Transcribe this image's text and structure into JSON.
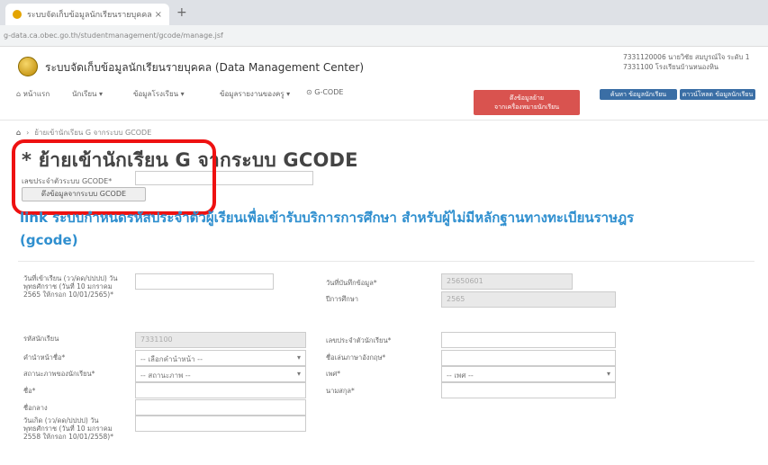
{
  "browser": {
    "tab_title": "ระบบจัดเก็บข้อมูลนักเรียนรายบุคคล",
    "tab_close": "×",
    "new_tab": "+",
    "url": "g-data.ca.obec.go.th/studentmanagement/gcode/manage.jsf"
  },
  "header": {
    "site_title": "ระบบจัดเก็บข้อมูลนักเรียนรายบุคคล (Data Management Center)",
    "user_line1": "7331120006 นายวิชัย สมบูรณ์ใจ  ระดับ 1",
    "user_line2": "7331100 โรงเรียนบ้านหนองหิน"
  },
  "nav": {
    "items": [
      "หน้าแรก",
      "นักเรียน ▾",
      "ข้อมูลโรงเรียน ▾",
      "ข้อมูลรายงานของครู ▾",
      "G-CODE"
    ],
    "red_button": "ดึงข้อมูลย้าย\nจากเครื่องหมายนักเรียน",
    "blue_buttons": [
      "ค้นหา ข้อมูลนักเรียน",
      "ดาวน์โหลด ข้อมูลนักเรียน"
    ]
  },
  "breadcrumb": {
    "home_icon": "home-icon",
    "separator": "›",
    "text": "ย้ายเข้านักเรียน G จากระบบ GCODE"
  },
  "page": {
    "title": "* ย้ายเข้านักเรียน G จากระบบ GCODE",
    "gcode_label": "เลขประจำตัวระบบ GCODE*",
    "gcode_value": "",
    "gcode_button": "ดึงข้อมูลจากระบบ GCODE",
    "link_text": "link ระบบกำหนดรหัสประจำตัวผู้เรียนเพื่อเข้ารับบริการการศึกษา สำหรับผู้ไม่มีหลักฐานทางทะเบียนราษฎร (gcode)"
  },
  "form": {
    "left": [
      {
        "label": "วันที่เข้าเรียน (วว/ดด/ปปปป) วันพุทธศักราช (วันที่ 10 มกราคม 2565 ให้กรอก 10/01/2565)*",
        "value": "",
        "type": "input"
      },
      {
        "label": "รหัสนักเรียน",
        "value": "7331100",
        "type": "input-disabled"
      },
      {
        "label": "คำนำหน้าชื่อ*",
        "value": "-- เลือกคำนำหน้า --",
        "type": "select"
      },
      {
        "label": "สถานะภาพของนักเรียน*",
        "value": "-- สถานะภาพ --",
        "type": "select"
      },
      {
        "label": "ชื่อ*",
        "value": "",
        "type": "input"
      },
      {
        "label": "ชื่อกลาง",
        "value": "",
        "type": "input"
      },
      {
        "label": "วันเกิด (วว/ดด/ปปปป) วันพุทธศักราช (วันที่ 10 มกราคม 2558 ให้กรอก 10/01/2558)*",
        "value": "",
        "type": "input"
      }
    ],
    "right": [
      {
        "label": "วันที่บันทึกข้อมูล*",
        "value": "25650601",
        "type": "input-disabled"
      },
      {
        "label": "ปีการศึกษา",
        "value": "2565",
        "type": "input-disabled"
      },
      {
        "label": "เลขประจำตัวนักเรียน*",
        "value": "",
        "type": "input"
      },
      {
        "label": "ชื่อเล่นภาษาอังกฤษ*",
        "value": "",
        "type": "input"
      },
      {
        "label": "เพศ*",
        "value": "-- เพศ --",
        "type": "select"
      },
      {
        "label": "นามสกุล*",
        "value": "",
        "type": "input"
      }
    ]
  },
  "colors": {
    "highlight": "#ee1111",
    "link": "#2f8fcf",
    "red_button": "#d9534f",
    "blue_button": "#3a6ea5"
  }
}
